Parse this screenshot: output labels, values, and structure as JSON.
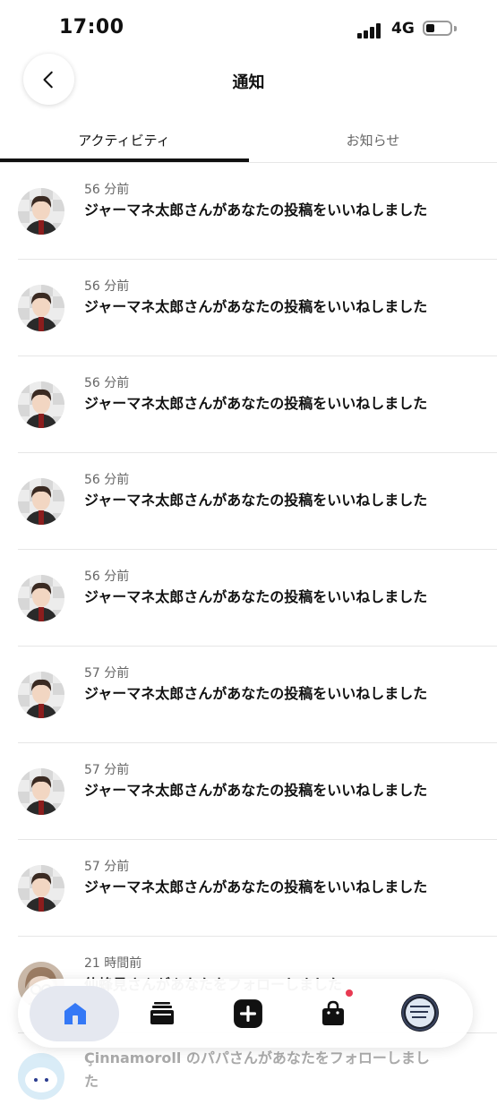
{
  "status_bar": {
    "time": "17:00",
    "network": "4G"
  },
  "header": {
    "title": "通知"
  },
  "tabs": [
    {
      "label": "アクティビティ",
      "active": true
    },
    {
      "label": "お知らせ",
      "active": false
    }
  ],
  "notifications": [
    {
      "time": "56 分前",
      "text": "ジャーマネ太郎さんがあなたの投稿をいいねしました"
    },
    {
      "time": "56 分前",
      "text": "ジャーマネ太郎さんがあなたの投稿をいいねしました"
    },
    {
      "time": "56 分前",
      "text": "ジャーマネ太郎さんがあなたの投稿をいいねしました"
    },
    {
      "time": "56 分前",
      "text": "ジャーマネ太郎さんがあなたの投稿をいいねしました"
    },
    {
      "time": "56 分前",
      "text": "ジャーマネ太郎さんがあなたの投稿をいいねしました"
    },
    {
      "time": "57 分前",
      "text": "ジャーマネ太郎さんがあなたの投稿をいいねしました"
    },
    {
      "time": "57 分前",
      "text": "ジャーマネ太郎さんがあなたの投稿をいいねしました"
    },
    {
      "time": "57 分前",
      "text": "ジャーマネ太郎さんがあなたの投稿をいいねしました"
    },
    {
      "time": "21 時間前",
      "text": "仙蜂見さんがあなたをフォローしました"
    },
    {
      "time": "",
      "text": "Çinnamoroll のパパさんがあなたをフォローしました"
    }
  ],
  "bottom_nav": {
    "items": [
      "home-icon",
      "library-icon",
      "add-icon",
      "shop-icon",
      "profile-avatar"
    ],
    "active": "home-icon",
    "accent_color": "#3478f6",
    "badge_color": "#e83a52"
  }
}
